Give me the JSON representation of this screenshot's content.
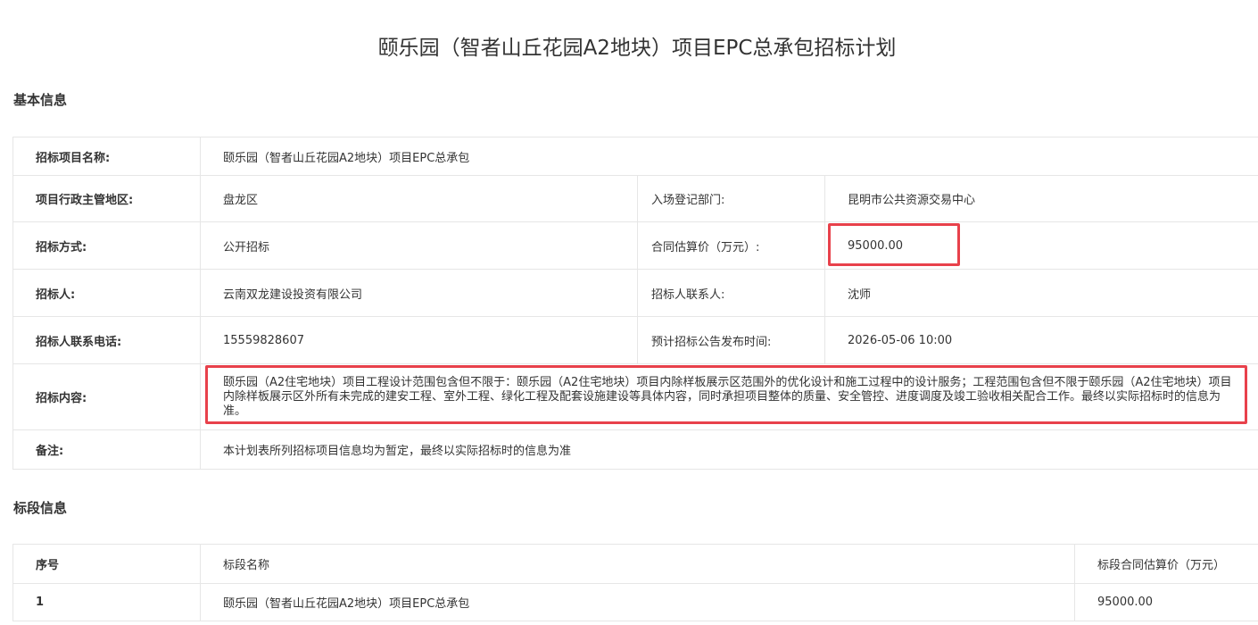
{
  "page": {
    "title": "颐乐园（智者山丘花园A2地块）项目EPC总承包招标计划"
  },
  "basic_info": {
    "section_title": "基本信息",
    "project_name_label": "招标项目名称:",
    "project_name": "颐乐园（智者山丘花园A2地块）项目EPC总承包",
    "admin_region_label": "项目行政主管地区:",
    "admin_region": "盘龙区",
    "registration_dept_label": "入场登记部门:",
    "registration_dept": "昆明市公共资源交易中心",
    "tender_method_label": "招标方式:",
    "tender_method": "公开招标",
    "contract_estimate_label": "合同估算价（万元）:",
    "contract_estimate": "95000.00",
    "tenderer_label": "招标人:",
    "tenderer": "云南双龙建设投资有限公司",
    "tenderer_contact_label": "招标人联系人:",
    "tenderer_contact": "沈师",
    "tenderer_phone_label": "招标人联系电话:",
    "tenderer_phone": "15559828607",
    "announce_time_label": "预计招标公告发布时间:",
    "announce_time": "2026-05-06 10:00",
    "tender_content_label": "招标内容:",
    "tender_content": "颐乐园（A2住宅地块）项目工程设计范围包含但不限于：颐乐园（A2住宅地块）项目内除样板展示区范围外的优化设计和施工过程中的设计服务；工程范围包含但不限于颐乐园（A2住宅地块）项目内除样板展示区外所有未完成的建安工程、室外工程、绿化工程及配套设施建设等具体内容，同时承担项目整体的质量、安全管控、进度调度及竣工验收相关配合工作。最终以实际招标时的信息为准。",
    "remarks_label": "备注:",
    "remarks": "本计划表所列招标项目信息均为暂定，最终以实际招标时的信息为准"
  },
  "segment_info": {
    "section_title": "标段信息",
    "headers": {
      "index": "序号",
      "name": "标段名称",
      "estimate": "标段合同估算价（万元）"
    },
    "rows": [
      {
        "index": "1",
        "name": "颐乐园（智者山丘花园A2地块）项目EPC总承包",
        "estimate": "95000.00"
      }
    ]
  },
  "highlight_color": "#e8414b",
  "border_color": "#e6e6e6"
}
